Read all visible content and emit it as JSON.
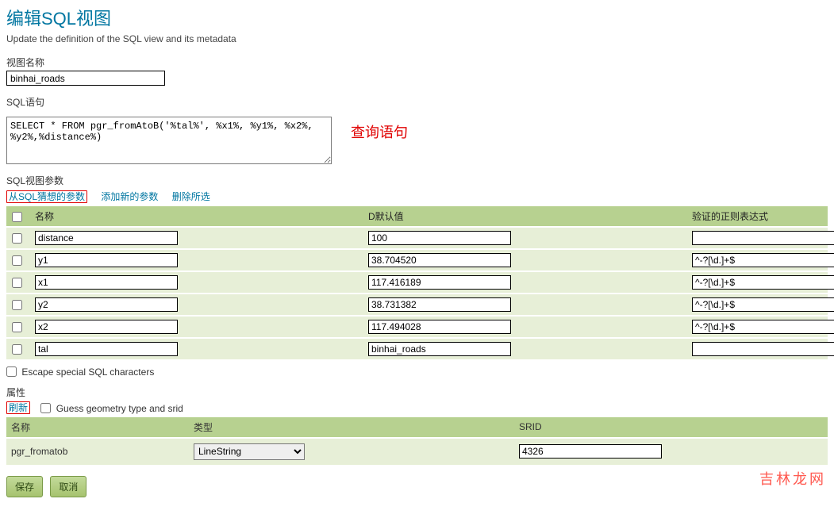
{
  "page": {
    "title": "编辑SQL视图",
    "subtitle": "Update the definition of the SQL view and its metadata"
  },
  "form": {
    "view_name_label": "视图名称",
    "view_name_value": "binhai_roads",
    "sql_label": "SQL语句",
    "sql_value": "SELECT * FROM pgr_fromAtoB('%tal%', %x1%, %y1%, %x2%, %y2%,%distance%)",
    "sql_annotation": "查询语句"
  },
  "params": {
    "section_label": "SQL视图参数",
    "links": {
      "guess": "从SQL猜想的参数",
      "add": "添加新的参数",
      "remove": "删除所选"
    },
    "headers": {
      "name": "名称",
      "default": "D默认值",
      "regex": "验证的正则表达式"
    },
    "rows": [
      {
        "name": "distance",
        "default": "100",
        "regex": ""
      },
      {
        "name": "y1",
        "default": "38.704520",
        "regex": "^-?[\\d.]+$"
      },
      {
        "name": "x1",
        "default": "117.416189",
        "regex": "^-?[\\d.]+$"
      },
      {
        "name": "y2",
        "default": "38.731382",
        "regex": "^-?[\\d.]+$"
      },
      {
        "name": "x2",
        "default": "117.494028",
        "regex": "^-?[\\d.]+$"
      },
      {
        "name": "tal",
        "default": "binhai_roads",
        "regex": ""
      }
    ]
  },
  "escape": {
    "label": "Escape special SQL characters"
  },
  "attributes": {
    "section_label": "属性",
    "refresh": "刷新",
    "guess_label": "Guess geometry type and srid",
    "headers": {
      "name": "名称",
      "type": "类型",
      "srid": "SRID"
    },
    "row": {
      "name": "pgr_fromatob",
      "type": "LineString",
      "srid": "4326"
    }
  },
  "buttons": {
    "save": "保存",
    "cancel": "取消"
  },
  "watermark": "吉林龙网"
}
